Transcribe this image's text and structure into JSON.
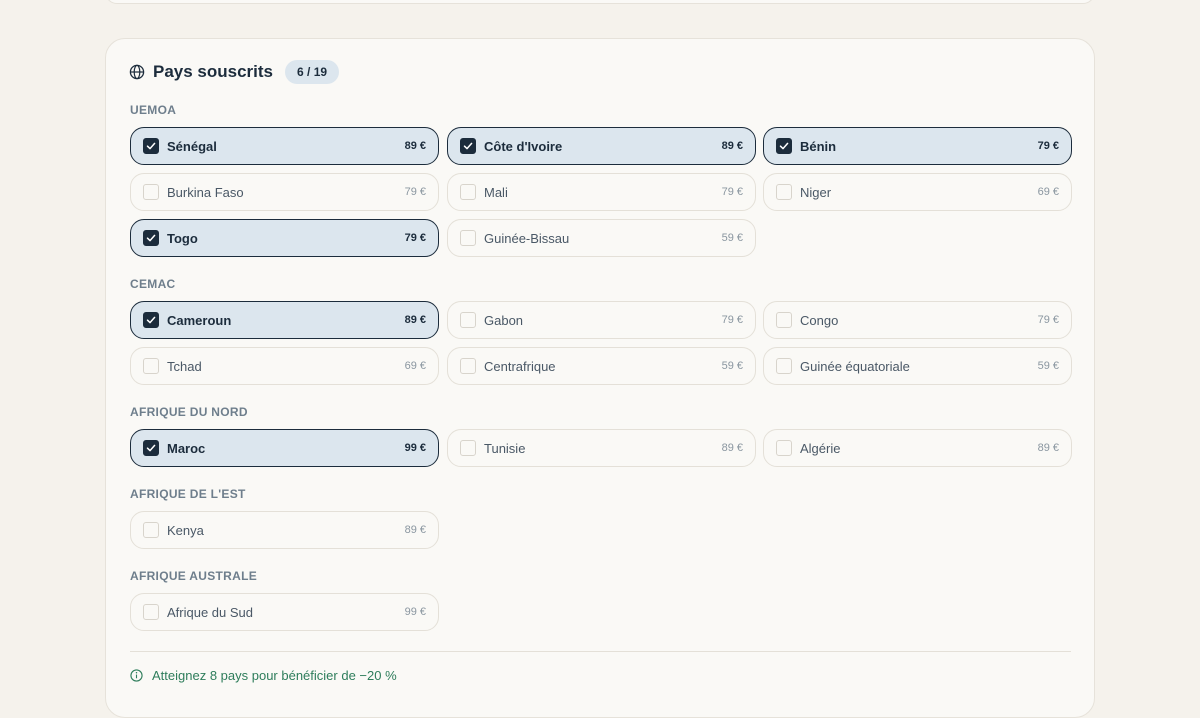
{
  "header": {
    "title": "Pays souscrits",
    "count_badge": "6 / 19"
  },
  "colors": {
    "selected_bg": "#dce6ee",
    "selected_border": "#1c2c3c",
    "accent_green": "#2e7d5b"
  },
  "sections": [
    {
      "label": "UEMOA",
      "items": [
        {
          "name": "Sénégal",
          "price": "89 €",
          "checked": true
        },
        {
          "name": "Côte d'Ivoire",
          "price": "89 €",
          "checked": true
        },
        {
          "name": "Bénin",
          "price": "79 €",
          "checked": true
        },
        {
          "name": "Burkina Faso",
          "price": "79 €",
          "checked": false
        },
        {
          "name": "Mali",
          "price": "79 €",
          "checked": false
        },
        {
          "name": "Niger",
          "price": "69 €",
          "checked": false
        },
        {
          "name": "Togo",
          "price": "79 €",
          "checked": true
        },
        {
          "name": "Guinée-Bissau",
          "price": "59 €",
          "checked": false
        }
      ]
    },
    {
      "label": "CEMAC",
      "items": [
        {
          "name": "Cameroun",
          "price": "89 €",
          "checked": true
        },
        {
          "name": "Gabon",
          "price": "79 €",
          "checked": false
        },
        {
          "name": "Congo",
          "price": "79 €",
          "checked": false
        },
        {
          "name": "Tchad",
          "price": "69 €",
          "checked": false
        },
        {
          "name": "Centrafrique",
          "price": "59 €",
          "checked": false
        },
        {
          "name": "Guinée équatoriale",
          "price": "59 €",
          "checked": false
        }
      ]
    },
    {
      "label": "AFRIQUE DU NORD",
      "items": [
        {
          "name": "Maroc",
          "price": "99 €",
          "checked": true
        },
        {
          "name": "Tunisie",
          "price": "89 €",
          "checked": false
        },
        {
          "name": "Algérie",
          "price": "89 €",
          "checked": false
        }
      ]
    },
    {
      "label": "AFRIQUE DE L'EST",
      "items": [
        {
          "name": "Kenya",
          "price": "89 €",
          "checked": false
        }
      ]
    },
    {
      "label": "AFRIQUE AUSTRALE",
      "items": [
        {
          "name": "Afrique du Sud",
          "price": "99 €",
          "checked": false
        }
      ]
    }
  ],
  "footer": {
    "note": "Atteignez 8 pays pour bénéficier de −20 %",
    "icon": "info-circle-icon"
  }
}
